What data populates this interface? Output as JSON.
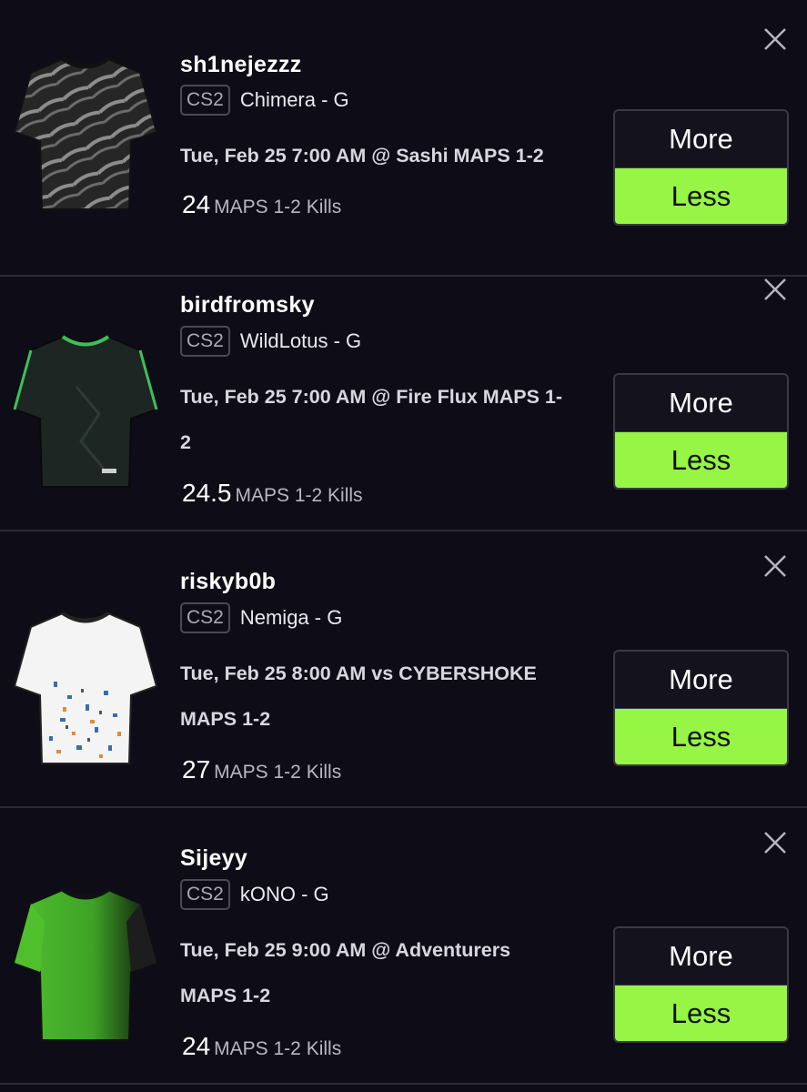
{
  "cards": [
    {
      "player": "sh1nejezzz",
      "game_badge": "CS2",
      "team": "Chimera - G",
      "matchup_line1": "Tue, Feb 25 7:00 AM @ Sashi MAPS 1-2",
      "matchup_line2": "",
      "line_value": "24",
      "stat_label": "MAPS 1-2 Kills",
      "more_label": "More",
      "less_label": "Less",
      "jersey_colors": [
        "#2a2a2a",
        "#8a8a8a"
      ]
    },
    {
      "player": "birdfromsky",
      "game_badge": "CS2",
      "team": "WildLotus - G",
      "matchup_line1": "Tue, Feb 25 7:00 AM @ Fire Flux MAPS 1-",
      "matchup_line2": "2",
      "line_value": "24.5",
      "stat_label": "MAPS 1-2 Kills",
      "more_label": "More",
      "less_label": "Less",
      "jersey_colors": [
        "#1f2a25",
        "#3fbf5a"
      ]
    },
    {
      "player": "riskyb0b",
      "game_badge": "CS2",
      "team": "Nemiga - G",
      "matchup_line1": "Tue, Feb 25 8:00 AM vs CYBERSHOKE",
      "matchup_line2": "MAPS 1-2",
      "line_value": "27",
      "stat_label": "MAPS 1-2 Kills",
      "more_label": "More",
      "less_label": "Less",
      "jersey_colors": [
        "#f4f4f4",
        "#3a6ea8"
      ]
    },
    {
      "player": "Sijeyy",
      "game_badge": "CS2",
      "team": "kONO - G",
      "matchup_line1": "Tue, Feb 25 9:00 AM @ Adventurers",
      "matchup_line2": "MAPS 1-2",
      "line_value": "24",
      "stat_label": "MAPS 1-2 Kills",
      "more_label": "More",
      "less_label": "Less",
      "jersey_colors": [
        "#4fbf2e",
        "#111111"
      ]
    }
  ],
  "icons": {
    "close": "close-icon",
    "jersey": "jersey-icon"
  },
  "colors": {
    "background": "#0e0d17",
    "less_button": "#96f545",
    "divider": "#2b2a35"
  }
}
